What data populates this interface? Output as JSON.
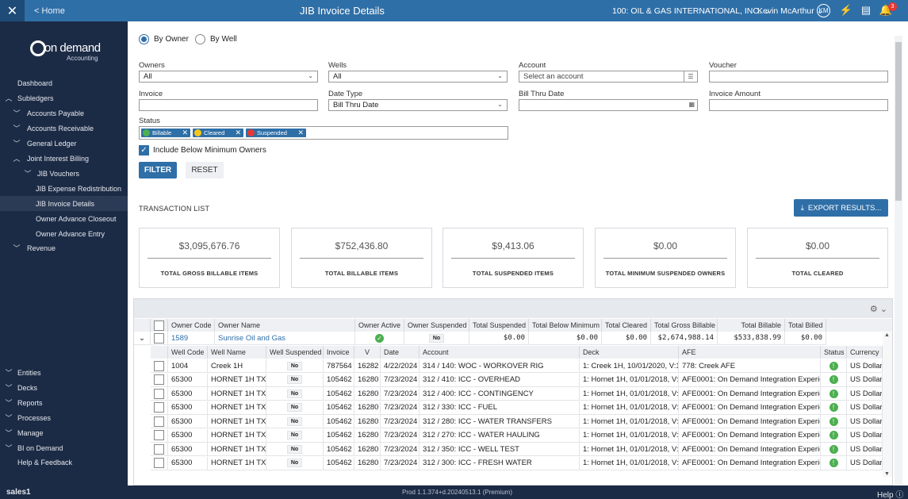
{
  "topbar": {
    "close_icon": "close-icon",
    "home_link": "< Home",
    "title": "JIB Invoice Details",
    "company": "100: OIL & GAS INTERNATIONAL, INC.",
    "user": "Kevin McArthur",
    "avatar_initials": "KM",
    "notifications_count": "3"
  },
  "logo": {
    "brand": "on demand",
    "sub": "Accounting"
  },
  "sidebar": {
    "items": [
      {
        "label": "Dashboard"
      },
      {
        "label": "Subledgers",
        "chev": "︿"
      },
      {
        "label": "Accounts Payable",
        "chev": "﹀"
      },
      {
        "label": "Accounts Receivable",
        "chev": "﹀"
      },
      {
        "label": "General Ledger",
        "chev": "﹀"
      },
      {
        "label": "Joint Interest Billing",
        "chev": "︿"
      },
      {
        "label": "JIB Vouchers",
        "chev": "﹀"
      },
      {
        "label": "JIB Expense Redistribution"
      },
      {
        "label": "JIB Invoice Details"
      },
      {
        "label": "Owner Advance Closeout"
      },
      {
        "label": "Owner Advance Entry"
      },
      {
        "label": "Revenue",
        "chev": "﹀"
      }
    ],
    "bottom_items": [
      {
        "label": "Entities",
        "chev": "﹀"
      },
      {
        "label": "Decks",
        "chev": "﹀"
      },
      {
        "label": "Reports",
        "chev": "﹀"
      },
      {
        "label": "Processes",
        "chev": "﹀"
      },
      {
        "label": "Manage",
        "chev": "﹀"
      },
      {
        "label": "BI on Demand",
        "chev": "﹀"
      },
      {
        "label": "Help & Feedback"
      }
    ]
  },
  "filters": {
    "by_owner": "By Owner",
    "by_well": "By Well",
    "owners_label": "Owners",
    "owners_value": "All",
    "wells_label": "Wells",
    "wells_value": "All",
    "account_label": "Account",
    "account_placeholder": "Select an account",
    "voucher_label": "Voucher",
    "voucher_value": "",
    "invoice_label": "Invoice",
    "invoice_value": "",
    "date_type_label": "Date Type",
    "date_type_value": "Bill Thru Date",
    "bill_thru_label": "Bill Thru Date",
    "bill_thru_value": "",
    "invoice_amount_label": "Invoice Amount",
    "invoice_amount_value": "",
    "status_label": "Status",
    "status_chips": [
      {
        "label": "Billable",
        "color": "#4caf50"
      },
      {
        "label": "Cleared",
        "color": "#f5c518"
      },
      {
        "label": "Suspended",
        "color": "#e53935"
      }
    ],
    "include_below_min": "Include Below Minimum Owners",
    "filter_button": "FILTER",
    "reset_button": "RESET"
  },
  "transaction_list": {
    "title": "TRANSACTION LIST",
    "export_button": "EXPORT RESULTS...",
    "cards": [
      {
        "amount": "$3,095,676.76",
        "label": "TOTAL GROSS BILLABLE ITEMS"
      },
      {
        "amount": "$752,436.80",
        "label": "TOTAL BILLABLE ITEMS"
      },
      {
        "amount": "$9,413.06",
        "label": "TOTAL SUSPENDED ITEMS"
      },
      {
        "amount": "$0.00",
        "label": "TOTAL MINIMUM SUSPENDED OWNERS"
      },
      {
        "amount": "$0.00",
        "label": "TOTAL CLEARED"
      }
    ]
  },
  "grid": {
    "owner_headers": [
      "Owner Code",
      "Owner Name",
      "Owner Active",
      "Owner Suspended",
      "Total Suspended",
      "Total Below Minimum",
      "Total Cleared",
      "Total Gross Billable",
      "Total Billable",
      "Total Billed"
    ],
    "owner_row": {
      "code": "1589",
      "name": "Sunrise Oil and Gas",
      "active": "✓",
      "suspended": "No",
      "total_suspended": "$0.00",
      "total_below_min": "$0.00",
      "total_cleared": "$0.00",
      "total_gross_billable": "$2,674,988.14",
      "total_billable": "$533,838.99",
      "total_billed": "$0.00"
    },
    "detail_headers": [
      "Well Code",
      "Well Name",
      "Well Suspended",
      "Invoice",
      "V",
      "Date",
      "Account",
      "Deck",
      "AFE",
      "Status",
      "Currency"
    ],
    "detail_rows": [
      {
        "well_code": "1004",
        "well_name": "Creek 1H",
        "suspended": "No",
        "invoice": "787564",
        "v": "16282",
        "date": "4/22/2024",
        "account": "314 / 140: WOC - WORKOVER RIG",
        "deck": "1: Creek 1H, 10/01/2020, V:1",
        "afe": "778: Creek AFE",
        "currency": "US Dollar"
      },
      {
        "well_code": "65300",
        "well_name": "HORNET 1H TX",
        "suspended": "No",
        "invoice": "105462",
        "v": "16280",
        "date": "7/23/2024",
        "account": "312 / 410: ICC - OVERHEAD",
        "deck": "1: Hornet 1H, 01/01/2018, V:1",
        "afe": "AFE0001: On Demand Integration Experien",
        "currency": "US Dollar"
      },
      {
        "well_code": "65300",
        "well_name": "HORNET 1H TX",
        "suspended": "No",
        "invoice": "105462",
        "v": "16280",
        "date": "7/23/2024",
        "account": "312 / 400: ICC - CONTINGENCY",
        "deck": "1: Hornet 1H, 01/01/2018, V:1",
        "afe": "AFE0001: On Demand Integration Experien",
        "currency": "US Dollar"
      },
      {
        "well_code": "65300",
        "well_name": "HORNET 1H TX",
        "suspended": "No",
        "invoice": "105462",
        "v": "16280",
        "date": "7/23/2024",
        "account": "312 / 330: ICC - FUEL",
        "deck": "1: Hornet 1H, 01/01/2018, V:1",
        "afe": "AFE0001: On Demand Integration Experien",
        "currency": "US Dollar"
      },
      {
        "well_code": "65300",
        "well_name": "HORNET 1H TX",
        "suspended": "No",
        "invoice": "105462",
        "v": "16280",
        "date": "7/23/2024",
        "account": "312 / 280: ICC - WATER TRANSFERS",
        "deck": "1: Hornet 1H, 01/01/2018, V:1",
        "afe": "AFE0001: On Demand Integration Experien",
        "currency": "US Dollar"
      },
      {
        "well_code": "65300",
        "well_name": "HORNET 1H TX",
        "suspended": "No",
        "invoice": "105462",
        "v": "16280",
        "date": "7/23/2024",
        "account": "312 / 270: ICC - WATER HAULING",
        "deck": "1: Hornet 1H, 01/01/2018, V:1",
        "afe": "AFE0001: On Demand Integration Experien",
        "currency": "US Dollar"
      },
      {
        "well_code": "65300",
        "well_name": "HORNET 1H TX",
        "suspended": "No",
        "invoice": "105462",
        "v": "16280",
        "date": "7/23/2024",
        "account": "312 / 350: ICC - WELL TEST",
        "deck": "1: Hornet 1H, 01/01/2018, V:1",
        "afe": "AFE0001: On Demand Integration Experien",
        "currency": "US Dollar"
      },
      {
        "well_code": "65300",
        "well_name": "HORNET 1H TX",
        "suspended": "No",
        "invoice": "105462",
        "v": "16280",
        "date": "7/23/2024",
        "account": "312 / 300: ICC - FRESH WATER",
        "deck": "1: Hornet 1H, 01/01/2018, V:1",
        "afe": "AFE0001: On Demand Integration Experien",
        "currency": "US Dollar"
      }
    ]
  },
  "statusbar": {
    "env": "sales1",
    "version": "Prod 1.1.374+d.20240513.1 (Premium)",
    "help": "Help"
  },
  "colors": {
    "accent": "#2f6fa7",
    "sidebar": "#1c2b45",
    "ok": "#4caf50"
  }
}
